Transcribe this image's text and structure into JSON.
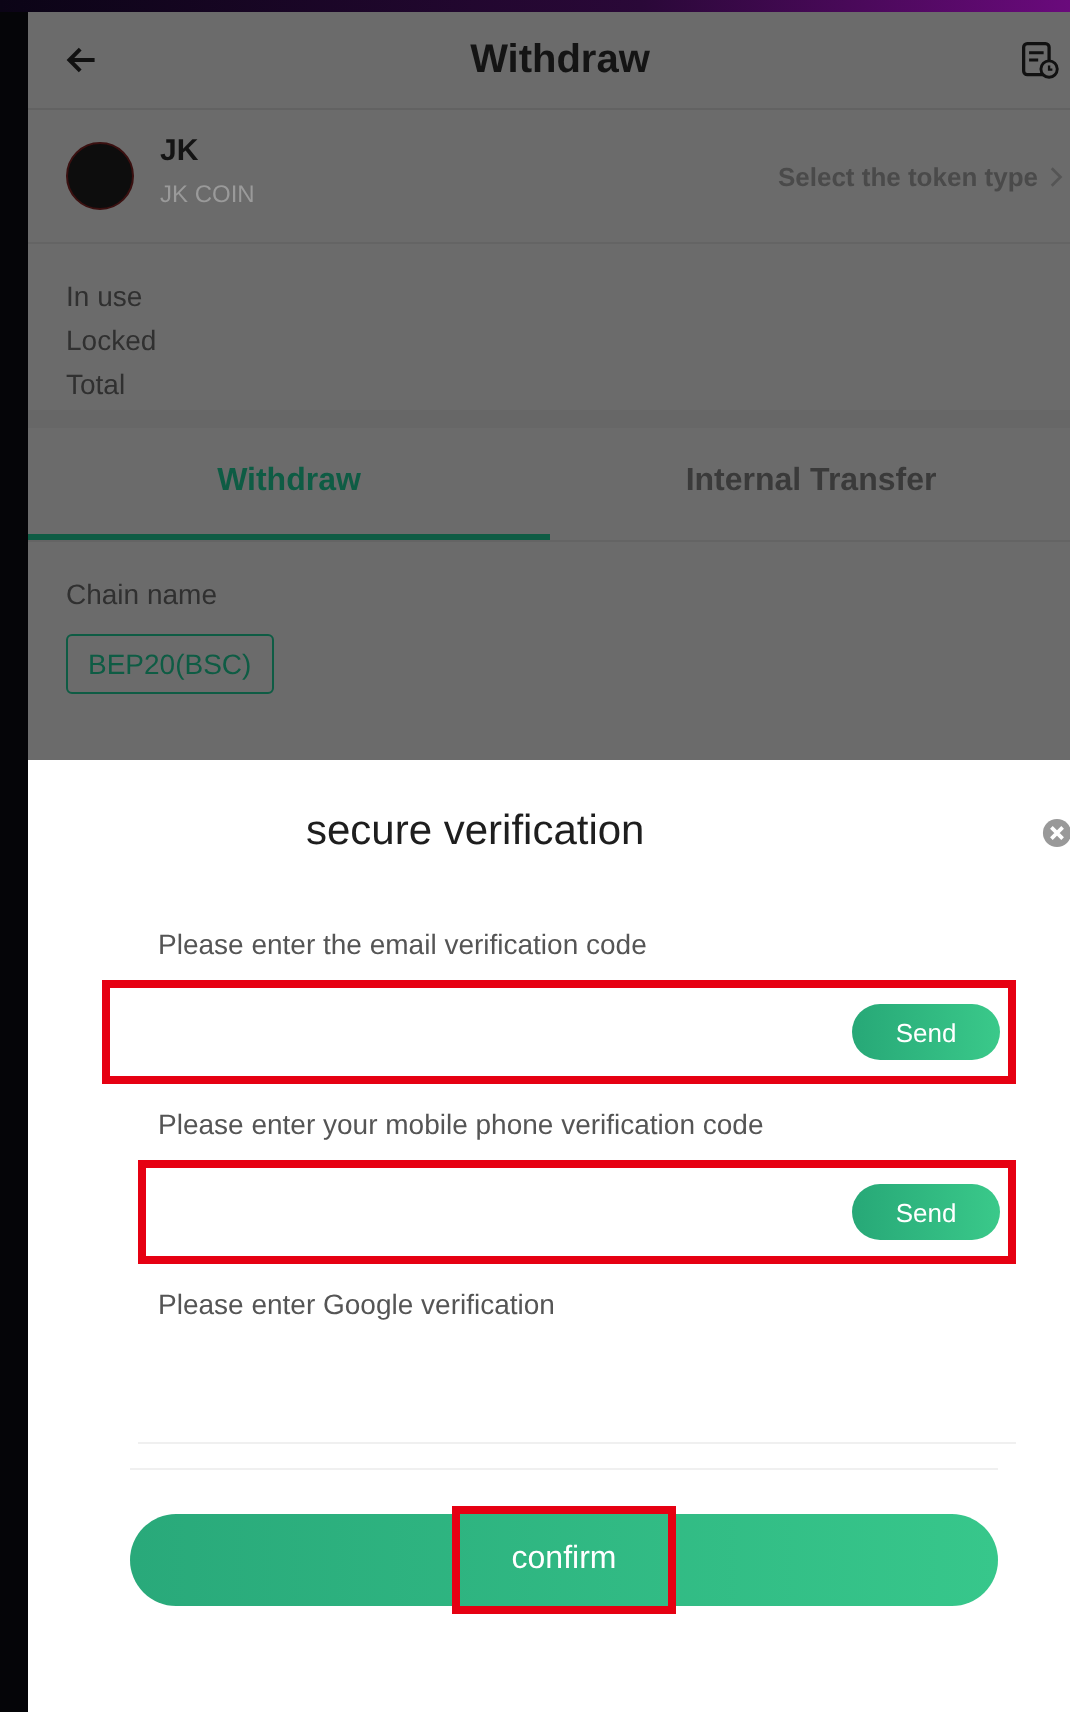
{
  "header": {
    "title": "Withdraw"
  },
  "token": {
    "symbol": "JK",
    "name": "JK COIN",
    "selector": "Select the token type"
  },
  "balances": [
    "In use",
    "Locked",
    "Total"
  ],
  "tabs": [
    {
      "label": "Withdraw",
      "selected": true
    },
    {
      "label": "Internal Transfer",
      "selected": false
    }
  ],
  "chain": {
    "label": "Chain name",
    "options": [
      {
        "label": "BEP20(BSC)",
        "selected": true
      }
    ]
  },
  "dialog": {
    "title": "secure verification",
    "fields": [
      {
        "kind": "send",
        "label": "Please enter the email verification code",
        "button": "Send",
        "highlighted": true
      },
      {
        "kind": "send",
        "label": "Please enter your mobile phone verification code",
        "button": "Send",
        "highlighted": true
      },
      {
        "kind": "plain",
        "label": "Please enter Google verification",
        "highlighted": false
      }
    ],
    "confirm": {
      "label": "confirm",
      "highlighted": true
    }
  }
}
